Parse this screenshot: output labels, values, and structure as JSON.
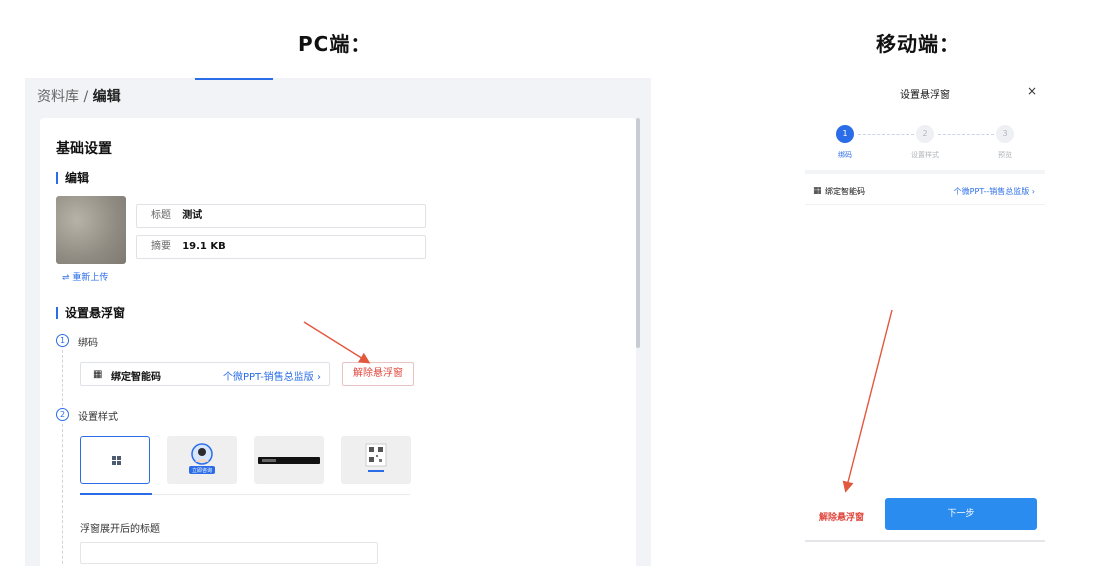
{
  "headings": {
    "pc": "PC端：",
    "mobile": "移动端："
  },
  "pc": {
    "breadcrumb": {
      "parent": "资料库 /",
      "current": "编辑"
    },
    "card_title": "基础设置",
    "edit_section": {
      "title": "编辑",
      "reupload_label": "⇌ 重新上传",
      "title_field": {
        "label": "标题",
        "value": "测试"
      },
      "summary_field": {
        "label": "摘要",
        "value": "19.1 KB"
      }
    },
    "float_section": {
      "title": "设置悬浮窗",
      "step1": {
        "num": "1",
        "label": "绑码"
      },
      "bind": {
        "label": "绑定智能码",
        "link": "个微PPT-销售总监版 ›",
        "unbind_button": "解除悬浮窗"
      },
      "step2": {
        "num": "2",
        "label": "设置样式"
      },
      "style_options": [
        "compact-icon",
        "avatar-card",
        "banner-bar",
        "qr-code"
      ],
      "avatar_caption": "立即咨询",
      "float_title_label": "浮窗展开后的标题"
    }
  },
  "mobile": {
    "title": "设置悬浮窗",
    "close": "×",
    "steps": [
      {
        "num": "1",
        "label": "绑码",
        "active": true
      },
      {
        "num": "2",
        "label": "设置样式",
        "active": false
      },
      {
        "num": "3",
        "label": "预览",
        "active": false
      }
    ],
    "bind_row": {
      "label": "绑定智能码",
      "link": "个微PPT--销售总监版 ›"
    },
    "unbind_label": "解除悬浮窗",
    "next_button": "下一步"
  },
  "colors": {
    "accent": "#2b6de8",
    "danger": "#e0463c",
    "arrow": "#e2583e"
  }
}
